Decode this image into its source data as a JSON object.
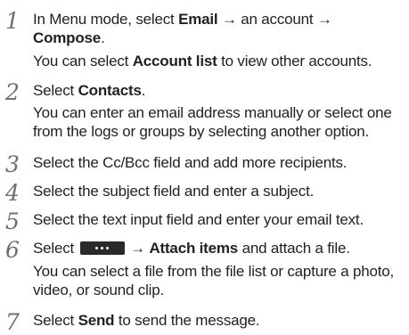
{
  "steps": [
    {
      "number": "1",
      "lines": [
        [
          "In Menu mode, select ",
          "Email",
          " → an account →"
        ],
        [
          "Compose",
          "."
        ],
        [
          "You can select ",
          "Account list",
          " to view other accounts."
        ]
      ]
    },
    {
      "number": "2",
      "lines": [
        [
          "Select ",
          "Contacts",
          "."
        ],
        [
          "You can enter an email address manually or select one"
        ],
        [
          "from the logs or groups by selecting another option."
        ]
      ]
    },
    {
      "number": "3",
      "lines": [
        [
          "Select the Cc/Bcc field and add more recipients."
        ]
      ]
    },
    {
      "number": "4",
      "lines": [
        [
          "Select the subject field and enter a subject."
        ]
      ]
    },
    {
      "number": "5",
      "lines": [
        [
          "Select the text input field and enter your email text."
        ]
      ]
    },
    {
      "number": "6",
      "lines": [
        [
          "Select ",
          " → ",
          "Attach items",
          " and attach a file."
        ],
        [
          "You can select a file from the file list or capture a photo,"
        ],
        [
          "video, or sound clip."
        ]
      ]
    },
    {
      "number": "7",
      "lines": [
        [
          "Select ",
          "Send",
          " to send the message."
        ]
      ]
    }
  ],
  "icons": {
    "more_button": "more-options-icon"
  }
}
